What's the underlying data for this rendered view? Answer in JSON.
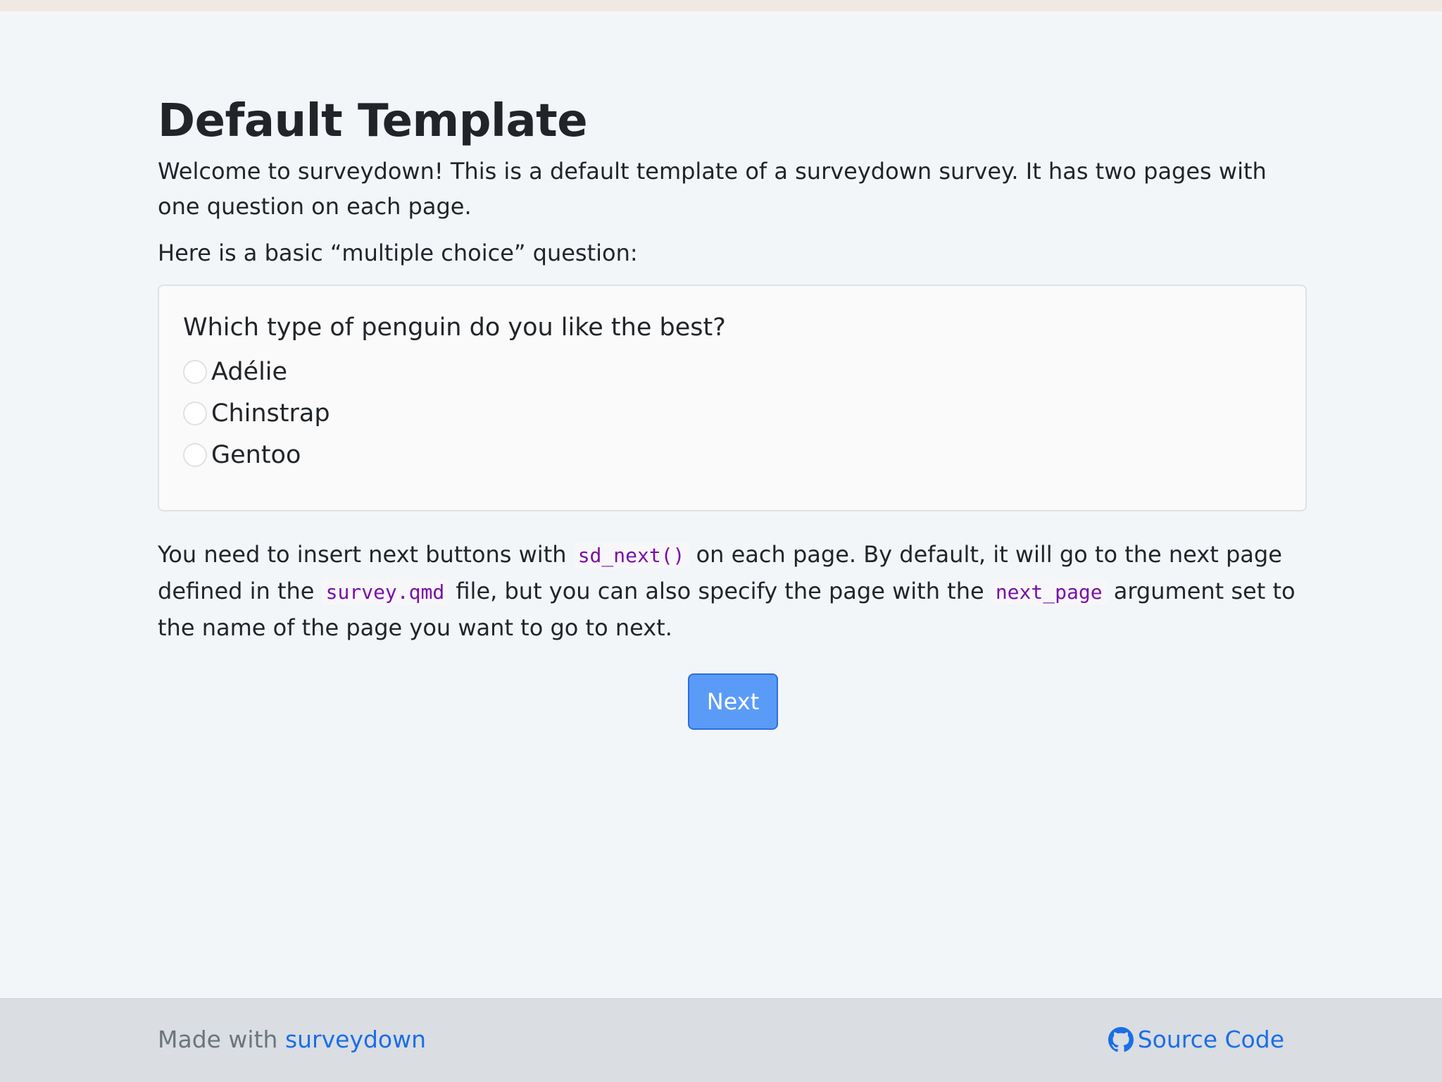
{
  "page": {
    "title": "Default Template",
    "intro": "Welcome to surveydown! This is a default template of a surveydown survey. It has two pages with one question on each page.",
    "lead": "Here is a basic “multiple choice” question:"
  },
  "question": {
    "label": "Which type of penguin do you like the best?",
    "options": [
      "Adélie",
      "Chinstrap",
      "Gentoo"
    ]
  },
  "explain": {
    "part1": "You need to insert next buttons with ",
    "code1": "sd_next()",
    "part2": " on each page. By default, it will go to the next page defined in the ",
    "code2": "survey.qmd",
    "part3": " file, but you can also specify the page with the ",
    "code3": "next_page",
    "part4": " argument set to the name of the page you want to go to next."
  },
  "next_button": {
    "label": "Next"
  },
  "footer": {
    "made_with": "Made with ",
    "brand_link": "surveydown",
    "source_link": "Source Code",
    "source_icon": "github-icon"
  },
  "colors": {
    "accent": "#1a6ee8",
    "button": "#5b9bf8",
    "code": "#7a0fa8",
    "background": "#f3f6f9",
    "footer": "#dadde1"
  }
}
